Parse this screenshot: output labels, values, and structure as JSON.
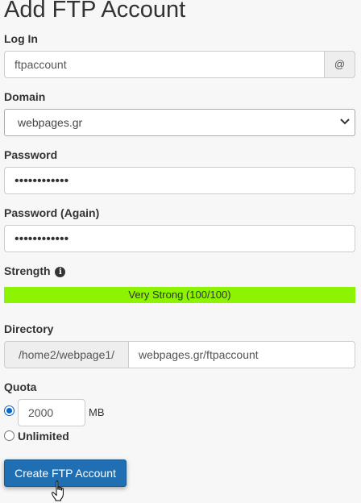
{
  "page_title": "Add FTP Account",
  "login": {
    "label": "Log In",
    "value": "ftpaccount",
    "addon": "@"
  },
  "domain": {
    "label": "Domain",
    "selected": "webpages.gr"
  },
  "password": {
    "label": "Password",
    "value": "••••••••••••"
  },
  "password_again": {
    "label": "Password (Again)",
    "value": "••••••••••••"
  },
  "strength": {
    "label": "Strength",
    "text": "Very Strong (100/100)",
    "percent": 100,
    "color": "#8cf300"
  },
  "directory": {
    "label": "Directory",
    "prefix": "/home2/webpage1/",
    "value": "webpages.gr/ftpaccount"
  },
  "quota": {
    "label": "Quota",
    "value": "2000",
    "unit": "MB",
    "unlimited_label": "Unlimited",
    "selected": "limited"
  },
  "submit_label": "Create FTP Account",
  "colors": {
    "primary_button": "#1f6fb2",
    "radio_accent": "#0a67c9"
  }
}
